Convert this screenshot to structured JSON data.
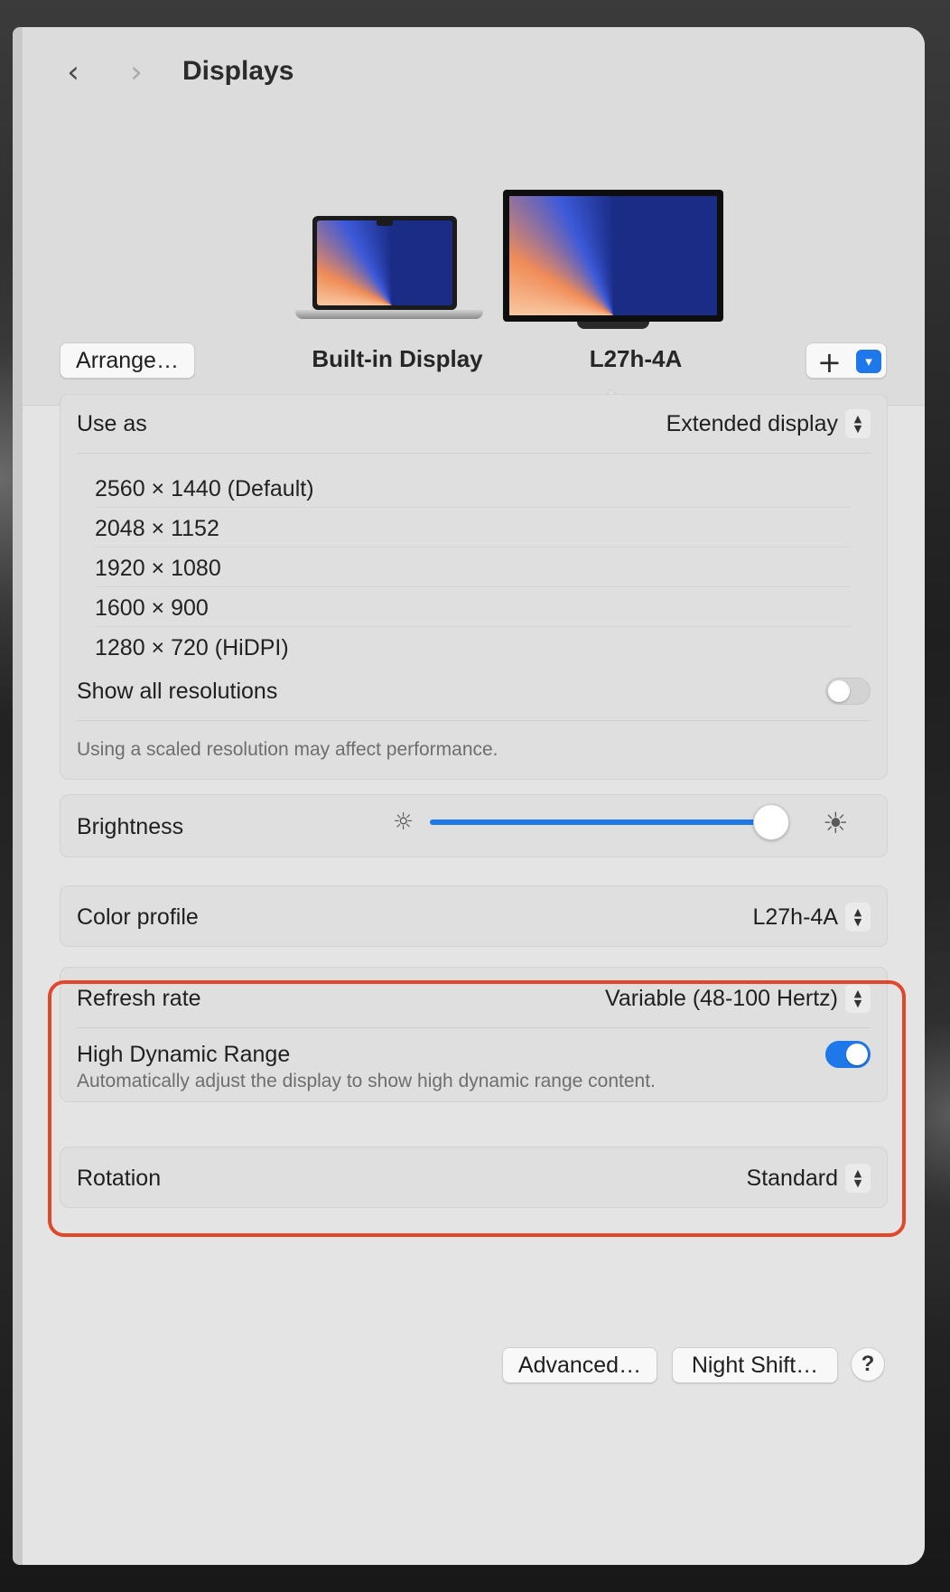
{
  "window": {
    "title": "Displays"
  },
  "nav": {
    "back_icon": "chevron-left-icon",
    "forward_icon": "chevron-right-icon"
  },
  "header": {
    "arrange_label": "Arrange…",
    "displays": [
      {
        "label": "Built-in Display",
        "icon": "laptop-icon"
      },
      {
        "label": "L27h-4A",
        "icon": "monitor-icon",
        "selected": true
      }
    ],
    "add_label": "+",
    "add_menu_icon": "chevron-down-icon"
  },
  "use_as": {
    "label": "Use as",
    "value": "Extended display"
  },
  "resolutions": [
    "2560 × 1440 (Default)",
    "2048 × 1152",
    "1920 × 1080",
    "1600 × 900",
    "1280 × 720 (HiDPI)"
  ],
  "show_all": {
    "label": "Show all resolutions",
    "enabled": false
  },
  "scaled_note": "Using a scaled resolution may affect performance.",
  "brightness": {
    "label": "Brightness",
    "level": 1.0
  },
  "color_profile": {
    "label": "Color profile",
    "value": "L27h-4A"
  },
  "refresh_rate": {
    "label": "Refresh rate",
    "value": "Variable (48-100 Hertz)"
  },
  "hdr": {
    "label": "High Dynamic Range",
    "description": "Automatically adjust the display to show high dynamic range content.",
    "enabled": true
  },
  "rotation": {
    "label": "Rotation",
    "value": "Standard"
  },
  "footer": {
    "advanced_label": "Advanced…",
    "night_shift_label": "Night Shift…",
    "help_label": "?"
  },
  "colors": {
    "accent": "#1f78ea",
    "highlight": "#e2472b",
    "window_bg": "#e4e4e4"
  }
}
